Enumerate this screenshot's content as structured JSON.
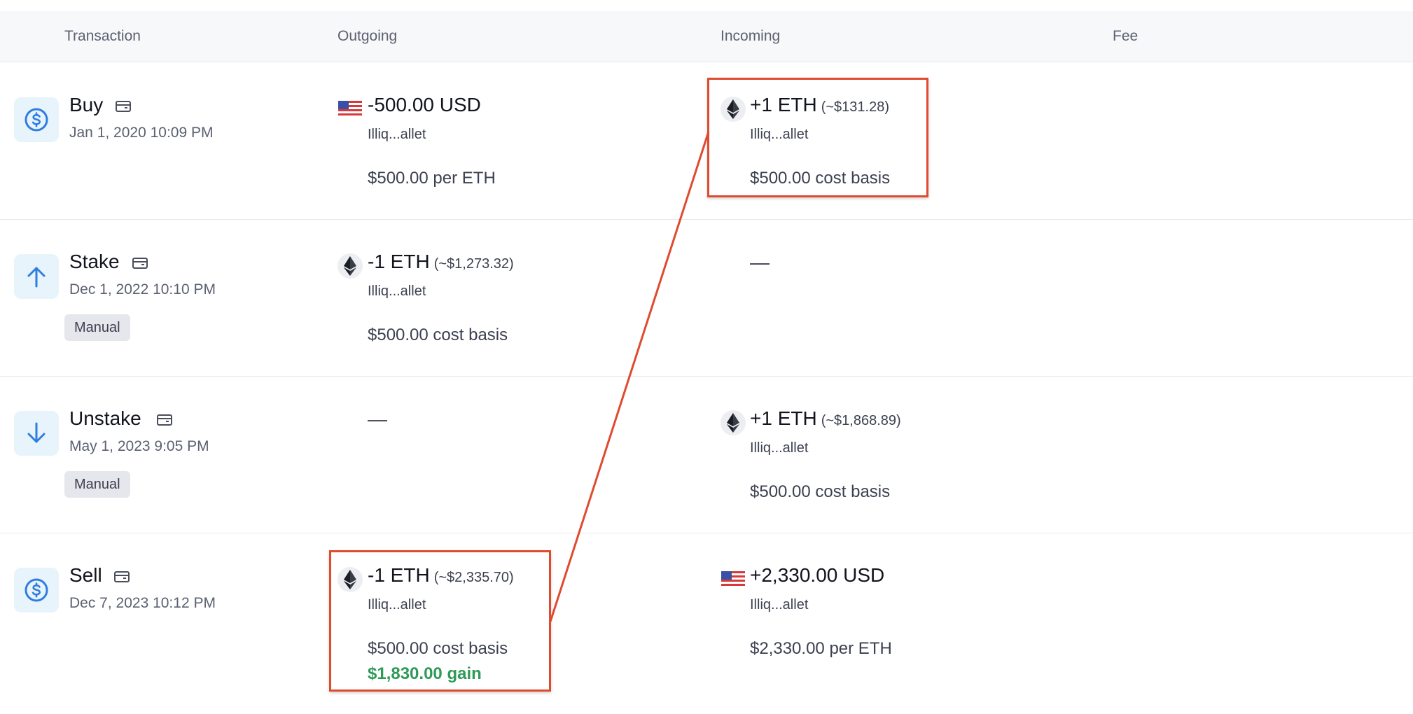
{
  "columns": {
    "transaction": "Transaction",
    "outgoing": "Outgoing",
    "incoming": "Incoming",
    "fee": "Fee"
  },
  "rows": [
    {
      "type": "Buy",
      "icon": "dollar-circle-icon",
      "date": "Jan 1, 2020 10:09 PM",
      "outgoing": {
        "amount": "-500.00 USD",
        "approx": "",
        "wallet": "Illiq...allet",
        "basis": "$500.00 per ETH",
        "gain": ""
      },
      "incoming": {
        "amount": "+1 ETH",
        "approx": "(~$131.28)",
        "wallet": "Illiq...allet",
        "basis": "$500.00 cost basis"
      }
    },
    {
      "type": "Stake",
      "icon": "arrow-up-icon",
      "date": "Dec 1, 2022 10:10 PM",
      "badge": "Manual",
      "outgoing": {
        "amount": "-1 ETH",
        "approx": "(~$1,273.32)",
        "wallet": "Illiq...allet",
        "basis": "$500.00 cost basis"
      },
      "incoming": {
        "dash": "—"
      }
    },
    {
      "type": "Unstake",
      "icon": "arrow-down-icon",
      "date": "May 1, 2023 9:05 PM",
      "badge": "Manual",
      "outgoing": {
        "dash": "—"
      },
      "incoming": {
        "amount": "+1 ETH",
        "approx": "(~$1,868.89)",
        "wallet": "Illiq...allet",
        "basis": "$500.00 cost basis"
      }
    },
    {
      "type": "Sell",
      "icon": "dollar-circle-icon",
      "date": "Dec 7, 2023 10:12 PM",
      "outgoing": {
        "amount": "-1 ETH",
        "approx": "(~$2,335.70)",
        "wallet": "Illiq...allet",
        "basis": "$500.00 cost basis",
        "gain": "$1,830.00 gain"
      },
      "incoming": {
        "amount": "+2,330.00 USD",
        "approx": "",
        "wallet": "Illiq...allet",
        "basis": "$2,330.00 per ETH"
      }
    }
  ],
  "colors": {
    "accent_blue": "#2f7de1",
    "icon_bg": "#e8f4fb",
    "gain_green": "#2e9a58",
    "highlight_red": "#e04a2f"
  }
}
